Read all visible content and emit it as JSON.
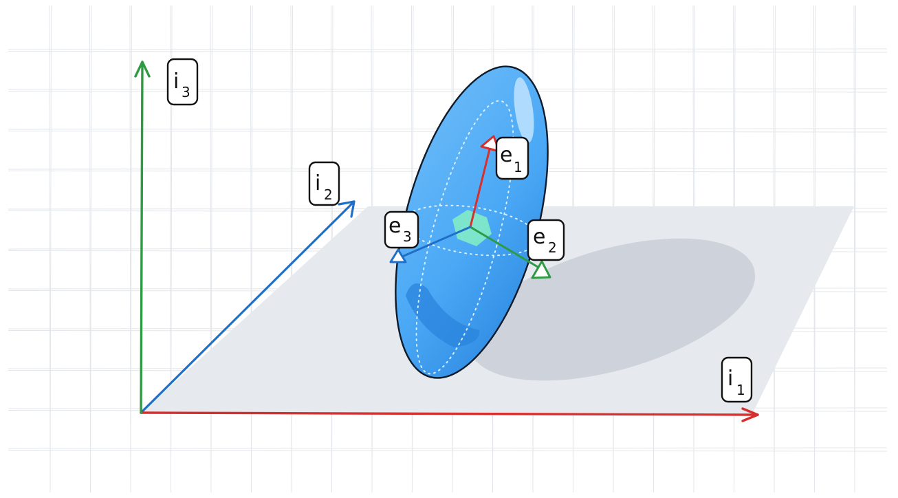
{
  "diagram": {
    "axes": [
      {
        "id": "i1",
        "base": "i",
        "sub": "1",
        "color": "#d62f2f"
      },
      {
        "id": "i2",
        "base": "i",
        "sub": "2",
        "color": "#1f6fc8"
      },
      {
        "id": "i3",
        "base": "i",
        "sub": "3",
        "color": "#2e9a44"
      }
    ],
    "eigenvectors": [
      {
        "id": "e1",
        "base": "e",
        "sub": "1",
        "color": "#d62f2f"
      },
      {
        "id": "e2",
        "base": "e",
        "sub": "2",
        "color": "#2e9a44"
      },
      {
        "id": "e3",
        "base": "e",
        "sub": "3",
        "color": "#1f6fc8"
      }
    ],
    "colors": {
      "grid": "#e3e6ea",
      "plane": "#e6e9ed",
      "shadow": "#c9ced6",
      "ellipsoid": "#4aa8f5",
      "ellipsoid_dark": "#2d8be3",
      "ellipsoid_outline": "#0d1b2a",
      "center_hexagon": "#7ee8c8"
    }
  }
}
